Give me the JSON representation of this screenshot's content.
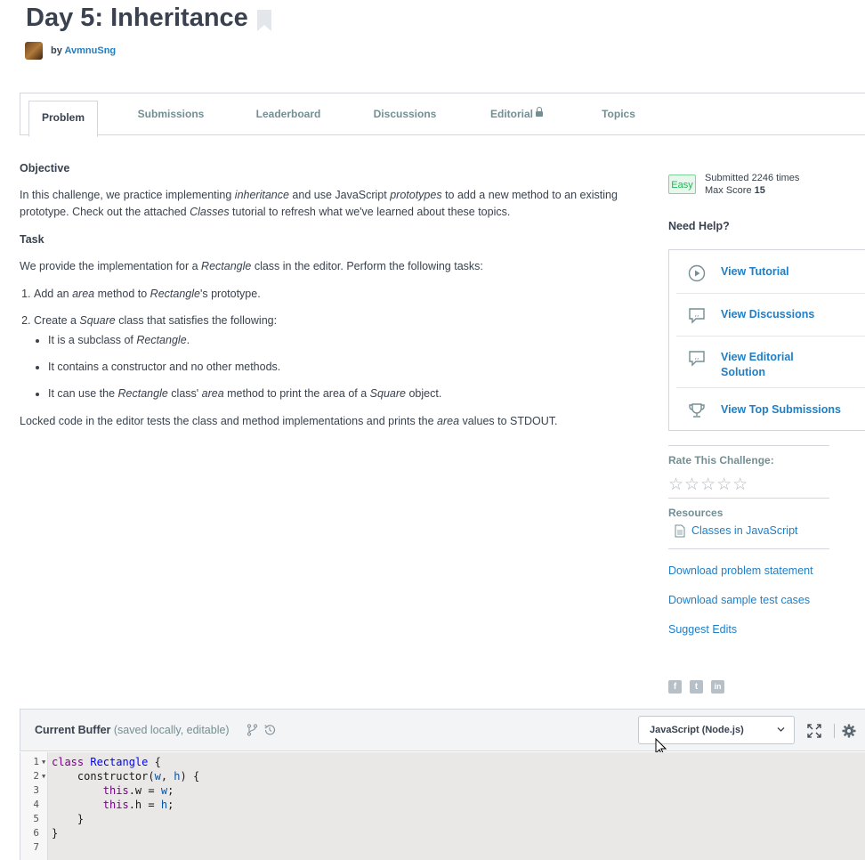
{
  "header": {
    "title": "Day 5: Inheritance",
    "by": "by",
    "author": "AvmnuSng"
  },
  "tabs": [
    {
      "label": "Problem"
    },
    {
      "label": "Submissions"
    },
    {
      "label": "Leaderboard"
    },
    {
      "label": "Discussions"
    },
    {
      "label": "Editorial"
    },
    {
      "label": "Topics"
    }
  ],
  "problem": {
    "objective_heading": "Objective",
    "objective": {
      "t1": "In this challenge, we practice implementing ",
      "e1": "inheritance",
      "t2": " and use JavaScript ",
      "e2": "prototypes",
      "t3": " to add a new method to an existing prototype. Check out the attached ",
      "e3": "Classes",
      "t4": " tutorial to refresh what we've learned about these topics."
    },
    "task_heading": "Task",
    "task_intro": {
      "t1": "We provide the implementation for a ",
      "e1": "Rectangle",
      "t2": " class in the editor. Perform the following tasks:"
    },
    "step1": {
      "t1": "Add an ",
      "e1": "area",
      "t2": " method to ",
      "e2": "Rectangle",
      "t3": "'s prototype."
    },
    "step2": {
      "t1": "Create a ",
      "e1": "Square",
      "t2": " class that satisfies the following:"
    },
    "bullet1": {
      "t1": "It is a subclass of ",
      "e1": "Rectangle",
      "t2": "."
    },
    "bullet2": "It contains a constructor and no other methods.",
    "bullet3": {
      "t1": "It can use the ",
      "e1": "Rectangle",
      "t2": " class' ",
      "e2": "area",
      "t3": " method to print the area of a ",
      "e3": "Square",
      "t4": " object."
    },
    "footer": {
      "t1": "Locked code in the editor tests the class and method implementations and prints the ",
      "e1": "area",
      "t2": " values to STDOUT."
    }
  },
  "sidebar": {
    "difficulty": "Easy",
    "submitted_prefix": "Submitted ",
    "submitted_count": "2246",
    "submitted_suffix": " times",
    "max_score_label": "Max Score ",
    "max_score": "15",
    "need_help": "Need Help?",
    "help_items": [
      {
        "label": "View Tutorial",
        "icon": "play-circle-icon"
      },
      {
        "label": "View Discussions",
        "icon": "comment-quote-icon"
      },
      {
        "label": "View Editorial Solution",
        "icon": "comment-quote-icon"
      },
      {
        "label": "View Top Submissions",
        "icon": "trophy-icon"
      }
    ],
    "rate_heading": "Rate This Challenge:",
    "rating": 0,
    "rating_max": 5,
    "resources_heading": "Resources",
    "resource_link": "Classes in JavaScript",
    "links": [
      "Download problem statement",
      "Download sample test cases",
      "Suggest Edits"
    ],
    "social": [
      "f",
      "t",
      "in"
    ]
  },
  "editor": {
    "buffer_label": "Current Buffer",
    "buffer_note": " (saved locally, editable)",
    "language": "JavaScript (Node.js)",
    "code_lines": [
      "class Rectangle {",
      "    constructor(w, h) {",
      "        this.w = w;",
      "        this.h = h;",
      "    }",
      "}",
      ""
    ]
  }
}
